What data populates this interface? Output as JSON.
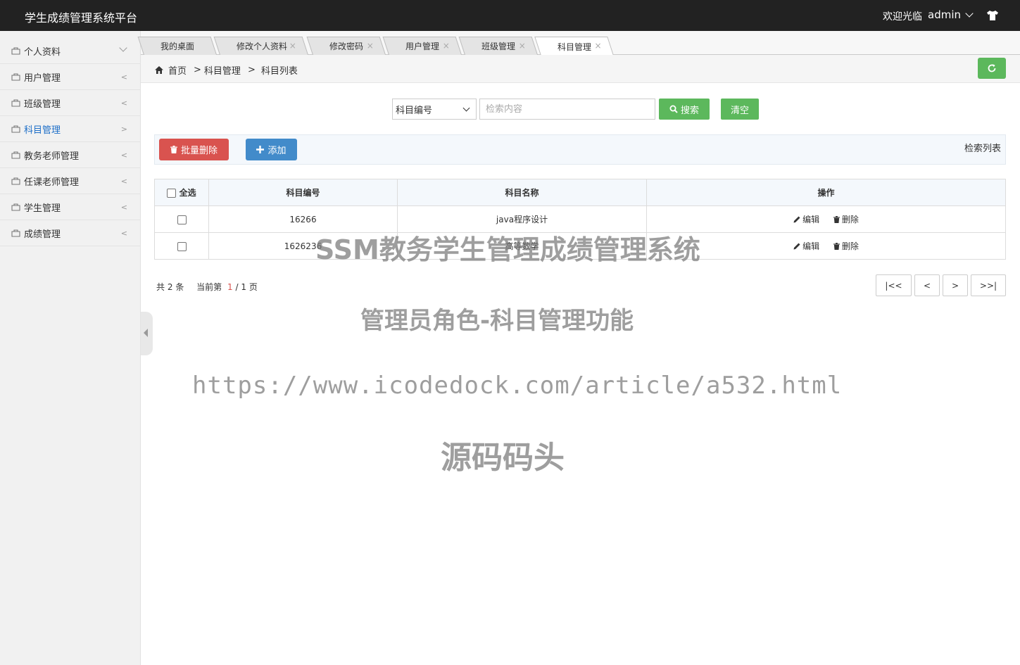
{
  "header": {
    "brand": "学生成绩管理系统平台",
    "welcome": "欢迎光临",
    "username": "admin",
    "shirt_icon": "shirt-icon"
  },
  "sidebar": {
    "items": [
      {
        "label": "个人资料",
        "icon": "bag-icon",
        "expanded": true
      },
      {
        "label": "用户管理",
        "icon": "bag-icon"
      },
      {
        "label": "班级管理",
        "icon": "bag-icon"
      },
      {
        "label": "科目管理",
        "icon": "bag-icon",
        "active": true
      },
      {
        "label": "教务老师管理",
        "icon": "bag-icon"
      },
      {
        "label": "任课老师管理",
        "icon": "bag-icon"
      },
      {
        "label": "学生管理",
        "icon": "bag-icon"
      },
      {
        "label": "成绩管理",
        "icon": "bag-icon"
      }
    ],
    "arrow": "<",
    "active_color": "#1e6fc8"
  },
  "tabs": [
    {
      "label": "我的桌面",
      "closable": false
    },
    {
      "label": "修改个人资料",
      "closable": true
    },
    {
      "label": "修改密码",
      "closable": true
    },
    {
      "label": "用户管理",
      "closable": true
    },
    {
      "label": "班级管理",
      "closable": true
    },
    {
      "label": "科目管理",
      "closable": true,
      "active": true
    }
  ],
  "tab_close": "×",
  "breadcrumb": {
    "home": "首页",
    "sep": ">",
    "level1": "科目管理",
    "level2": "科目列表"
  },
  "search": {
    "field_selected": "科目编号",
    "placeholder": "检索内容",
    "search_label": "搜索",
    "clear_label": "清空"
  },
  "toolbar": {
    "batch_delete_label": "批量删除",
    "add_label": "添加",
    "list_title": "检索列表"
  },
  "table": {
    "select_all": "全选",
    "columns": [
      "科目编号",
      "科目名称",
      "操作"
    ],
    "rows": [
      {
        "code": "16266",
        "name": "java程序设计"
      },
      {
        "code": "1626236",
        "name": "高等数学"
      }
    ],
    "edit_label": "编辑",
    "delete_label": "删除"
  },
  "pager": {
    "total_prefix": "共",
    "total": "2",
    "total_suffix": "条",
    "current_prefix": "当前第",
    "current": "1",
    "slash": "/",
    "pages": "1",
    "pages_suffix": "页",
    "first": "|<<",
    "prev": "<",
    "next": ">",
    "last": ">>|"
  },
  "watermark": {
    "line1": "SSM教务学生管理成绩管理系统",
    "line2": "管理员角色-科目管理功能",
    "line3": "https://www.icodedock.com/article/a532.html",
    "line4": "源码码头"
  },
  "colors": {
    "header_bg": "#222222",
    "green": "#5cb85c",
    "red": "#d9534f",
    "blue": "#428bca"
  }
}
